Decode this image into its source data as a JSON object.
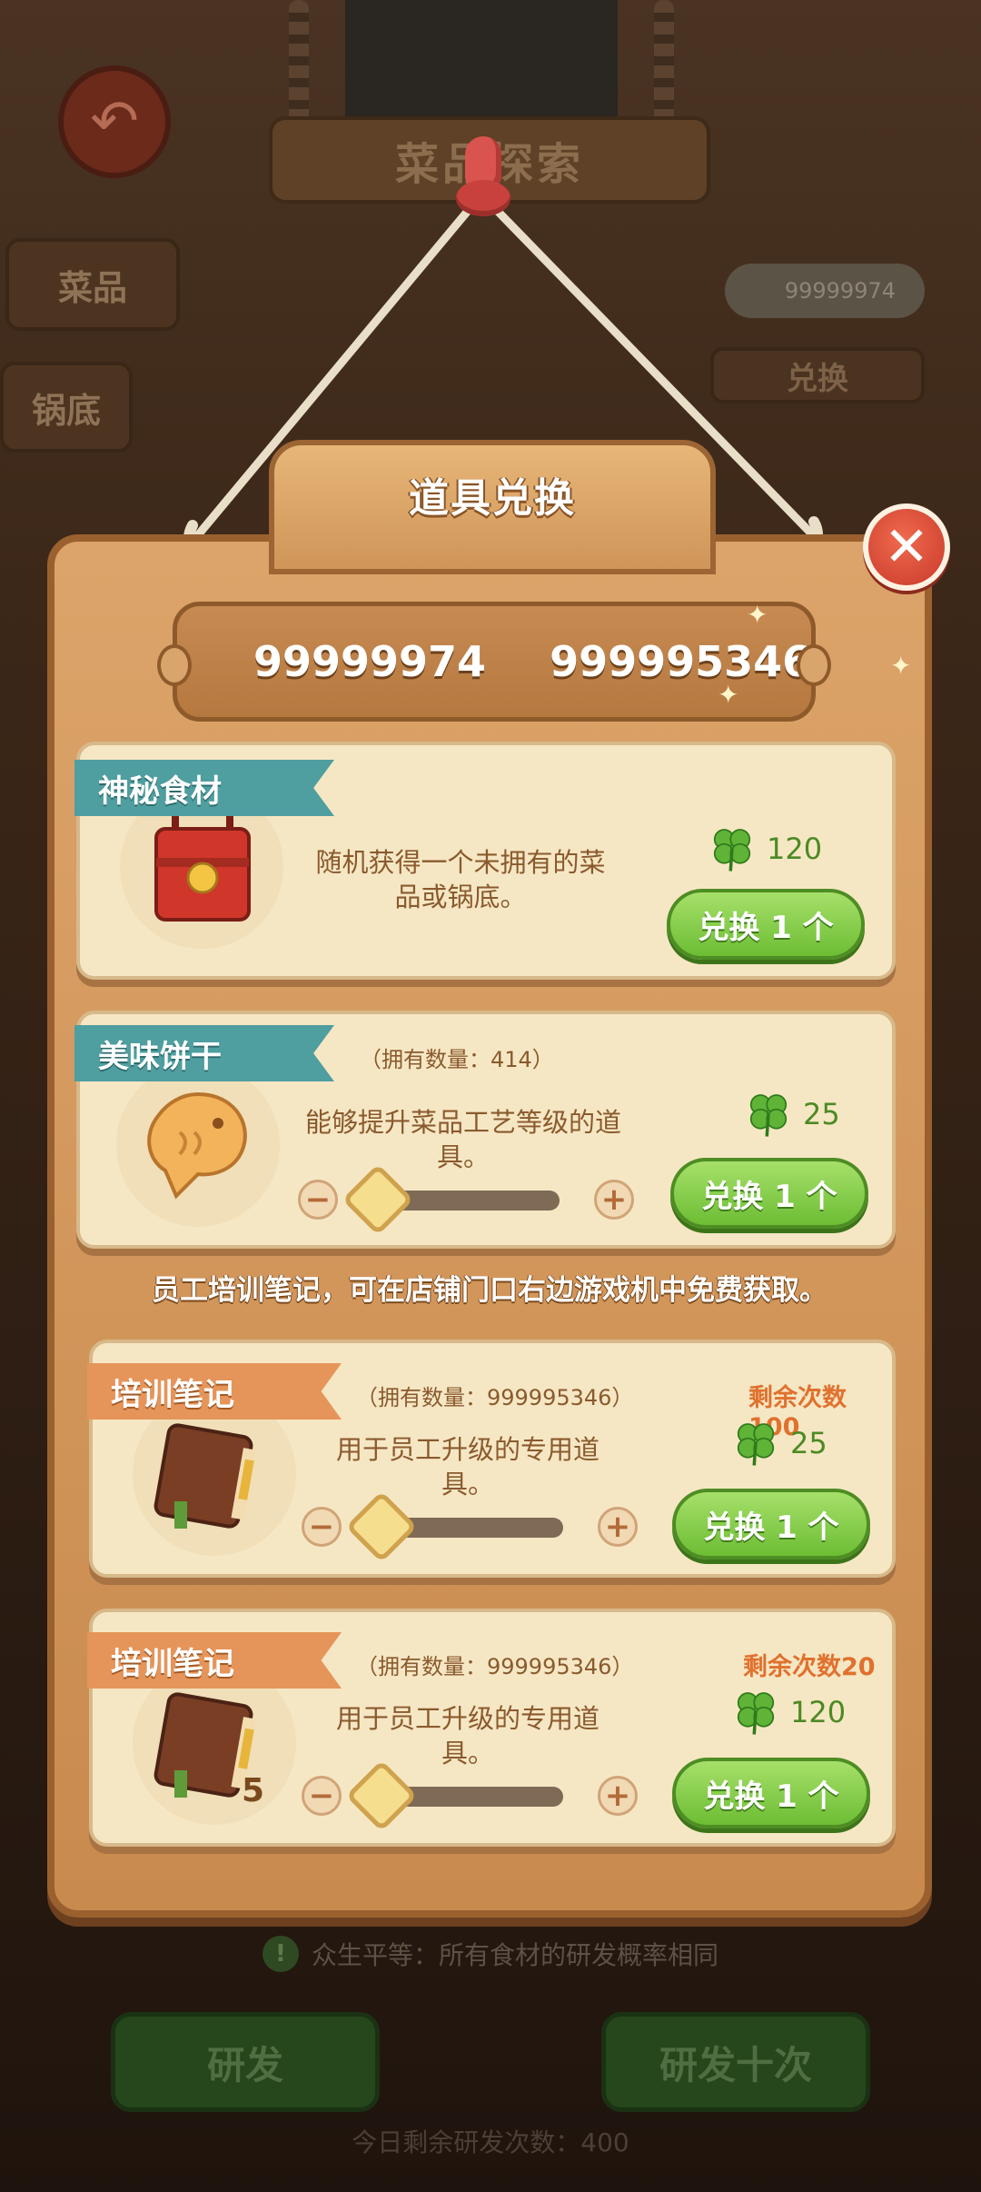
{
  "background": {
    "title_sign": "菜品探索",
    "tabs": [
      "菜品",
      "锅底"
    ],
    "clover_balance": "99999974",
    "exchange_label": "兑换",
    "notice": "众生平等：所有食材的研发概率相同",
    "buttons": [
      "研发",
      "研发十次"
    ],
    "remaining_today": "今日剩余研发次数：400"
  },
  "dialog": {
    "title": "道具兑换",
    "clover_count": "99999974",
    "notebook_count": "999995346",
    "info_line": "员工培训笔记，可在店铺门口右边游戏机中免费获取。",
    "items": [
      {
        "name": "神秘食材",
        "description": "随机获得一个未拥有的菜品或锅底。",
        "price": "120",
        "button": "兑换 1 个"
      },
      {
        "name": "美味饼干",
        "owned": "（拥有数量：414）",
        "description": "能够提升菜品工艺等级的道具。",
        "price": "25",
        "button": "兑换 1 个"
      },
      {
        "name": "培训笔记",
        "owned": "（拥有数量：999995346）",
        "remaining": "剩余次数100",
        "description": "用于员工升级的专用道具。",
        "price": "25",
        "button": "兑换 1 个"
      },
      {
        "name": "培训笔记",
        "owned": "（拥有数量：999995346）",
        "remaining": "剩余次数20",
        "description": "用于员工升级的专用道具。",
        "price": "120",
        "button": "兑换 1 个",
        "quantity_badge": "5"
      }
    ]
  },
  "colors": {
    "board": "#d49a5e",
    "card": "#f6e7c4",
    "green_button": "#7dc840",
    "teal_ribbon": "#4f9ea0",
    "orange_ribbon": "#e5955a",
    "close": "#d9472f"
  }
}
